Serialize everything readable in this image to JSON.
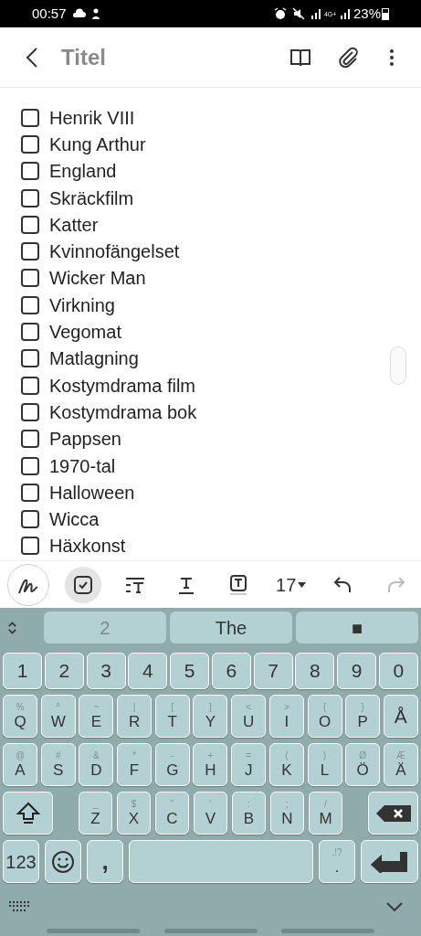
{
  "status_bar": {
    "time": "00:57",
    "network": "4G+",
    "battery": "23%"
  },
  "header": {
    "title": "Titel"
  },
  "checklist": [
    {
      "text": "Henrik VIII",
      "checked": false
    },
    {
      "text": "Kung Arthur",
      "checked": false
    },
    {
      "text": "England",
      "checked": false
    },
    {
      "text": "Skräckfilm",
      "checked": false
    },
    {
      "text": "Katter",
      "checked": false
    },
    {
      "text": "Kvinnofängelset",
      "checked": false
    },
    {
      "text": "Wicker Man",
      "checked": false
    },
    {
      "text": "Virkning",
      "checked": false
    },
    {
      "text": "Vegomat",
      "checked": false
    },
    {
      "text": "Matlagning",
      "checked": false
    },
    {
      "text": "Kostymdrama film",
      "checked": false
    },
    {
      "text": "Kostymdrama bok",
      "checked": false
    },
    {
      "text": "Pappsen",
      "checked": false
    },
    {
      "text": "1970-tal",
      "checked": false
    },
    {
      "text": "Halloween",
      "checked": false
    },
    {
      "text": "Wicca",
      "checked": false
    },
    {
      "text": "Häxkonst",
      "checked": false
    }
  ],
  "toolbar": [
    {
      "kind": "handwriting",
      "selected": false
    },
    {
      "kind": "checkbox",
      "selected": true
    },
    {
      "kind": "paragraph",
      "selected": false
    },
    {
      "kind": "text-color",
      "selected": false
    },
    {
      "kind": "highlight",
      "selected": false
    },
    {
      "kind": "font-size",
      "label": "17",
      "selected": false
    },
    {
      "kind": "undo",
      "disabled": false
    },
    {
      "kind": "redo",
      "disabled": true
    }
  ],
  "suggestions": [
    {
      "text": "2",
      "dim": true
    },
    {
      "text": "The",
      "dim": false
    },
    {
      "text": "■",
      "dim": false
    }
  ],
  "keyboard": [
    [
      {
        "kind": "char",
        "label": "1"
      },
      {
        "kind": "char",
        "label": "2"
      },
      {
        "kind": "char",
        "label": "3"
      },
      {
        "kind": "char",
        "label": "4"
      },
      {
        "kind": "char",
        "label": "5"
      },
      {
        "kind": "char",
        "label": "6"
      },
      {
        "kind": "char",
        "label": "7"
      },
      {
        "kind": "char",
        "label": "8"
      },
      {
        "kind": "char",
        "label": "9"
      },
      {
        "kind": "char",
        "label": "0"
      }
    ],
    [
      {
        "kind": "char",
        "label": "Q",
        "alt": "%"
      },
      {
        "kind": "char",
        "label": "W",
        "alt": "^"
      },
      {
        "kind": "char",
        "label": "E",
        "alt": "~"
      },
      {
        "kind": "char",
        "label": "R",
        "alt": "|"
      },
      {
        "kind": "char",
        "label": "T",
        "alt": "["
      },
      {
        "kind": "char",
        "label": "Y",
        "alt": "]"
      },
      {
        "kind": "char",
        "label": "U",
        "alt": "<"
      },
      {
        "kind": "char",
        "label": "I",
        "alt": ">"
      },
      {
        "kind": "char",
        "label": "O",
        "alt": "{"
      },
      {
        "kind": "char",
        "label": "P",
        "alt": "}"
      },
      {
        "kind": "char",
        "label": "Å"
      }
    ],
    [
      {
        "kind": "char",
        "label": "A",
        "alt": "@"
      },
      {
        "kind": "char",
        "label": "S",
        "alt": "#"
      },
      {
        "kind": "char",
        "label": "D",
        "alt": "&"
      },
      {
        "kind": "char",
        "label": "F",
        "alt": "*"
      },
      {
        "kind": "char",
        "label": "G",
        "alt": "-"
      },
      {
        "kind": "char",
        "label": "H",
        "alt": "+"
      },
      {
        "kind": "char",
        "label": "J",
        "alt": "="
      },
      {
        "kind": "char",
        "label": "K",
        "alt": "("
      },
      {
        "kind": "char",
        "label": "L",
        "alt": ")"
      },
      {
        "kind": "char",
        "label": "Ö",
        "alt": "Ø"
      },
      {
        "kind": "char",
        "label": "Ä",
        "alt": "Æ"
      }
    ],
    [
      {
        "kind": "shift"
      },
      {
        "kind": "char",
        "label": "Z",
        "alt": "_"
      },
      {
        "kind": "char",
        "label": "X",
        "alt": "$"
      },
      {
        "kind": "char",
        "label": "C",
        "alt": "\""
      },
      {
        "kind": "char",
        "label": "V",
        "alt": "'"
      },
      {
        "kind": "char",
        "label": "B",
        "alt": ":"
      },
      {
        "kind": "char",
        "label": "N",
        "alt": ";"
      },
      {
        "kind": "char",
        "label": "M",
        "alt": "/"
      },
      {
        "kind": "backspace"
      }
    ],
    [
      {
        "kind": "mode",
        "label": "123"
      },
      {
        "kind": "emoji"
      },
      {
        "kind": "comma",
        "label": ","
      },
      {
        "kind": "space"
      },
      {
        "kind": "char",
        "label": ".",
        "alt": ",!?"
      },
      {
        "kind": "enter"
      }
    ]
  ]
}
